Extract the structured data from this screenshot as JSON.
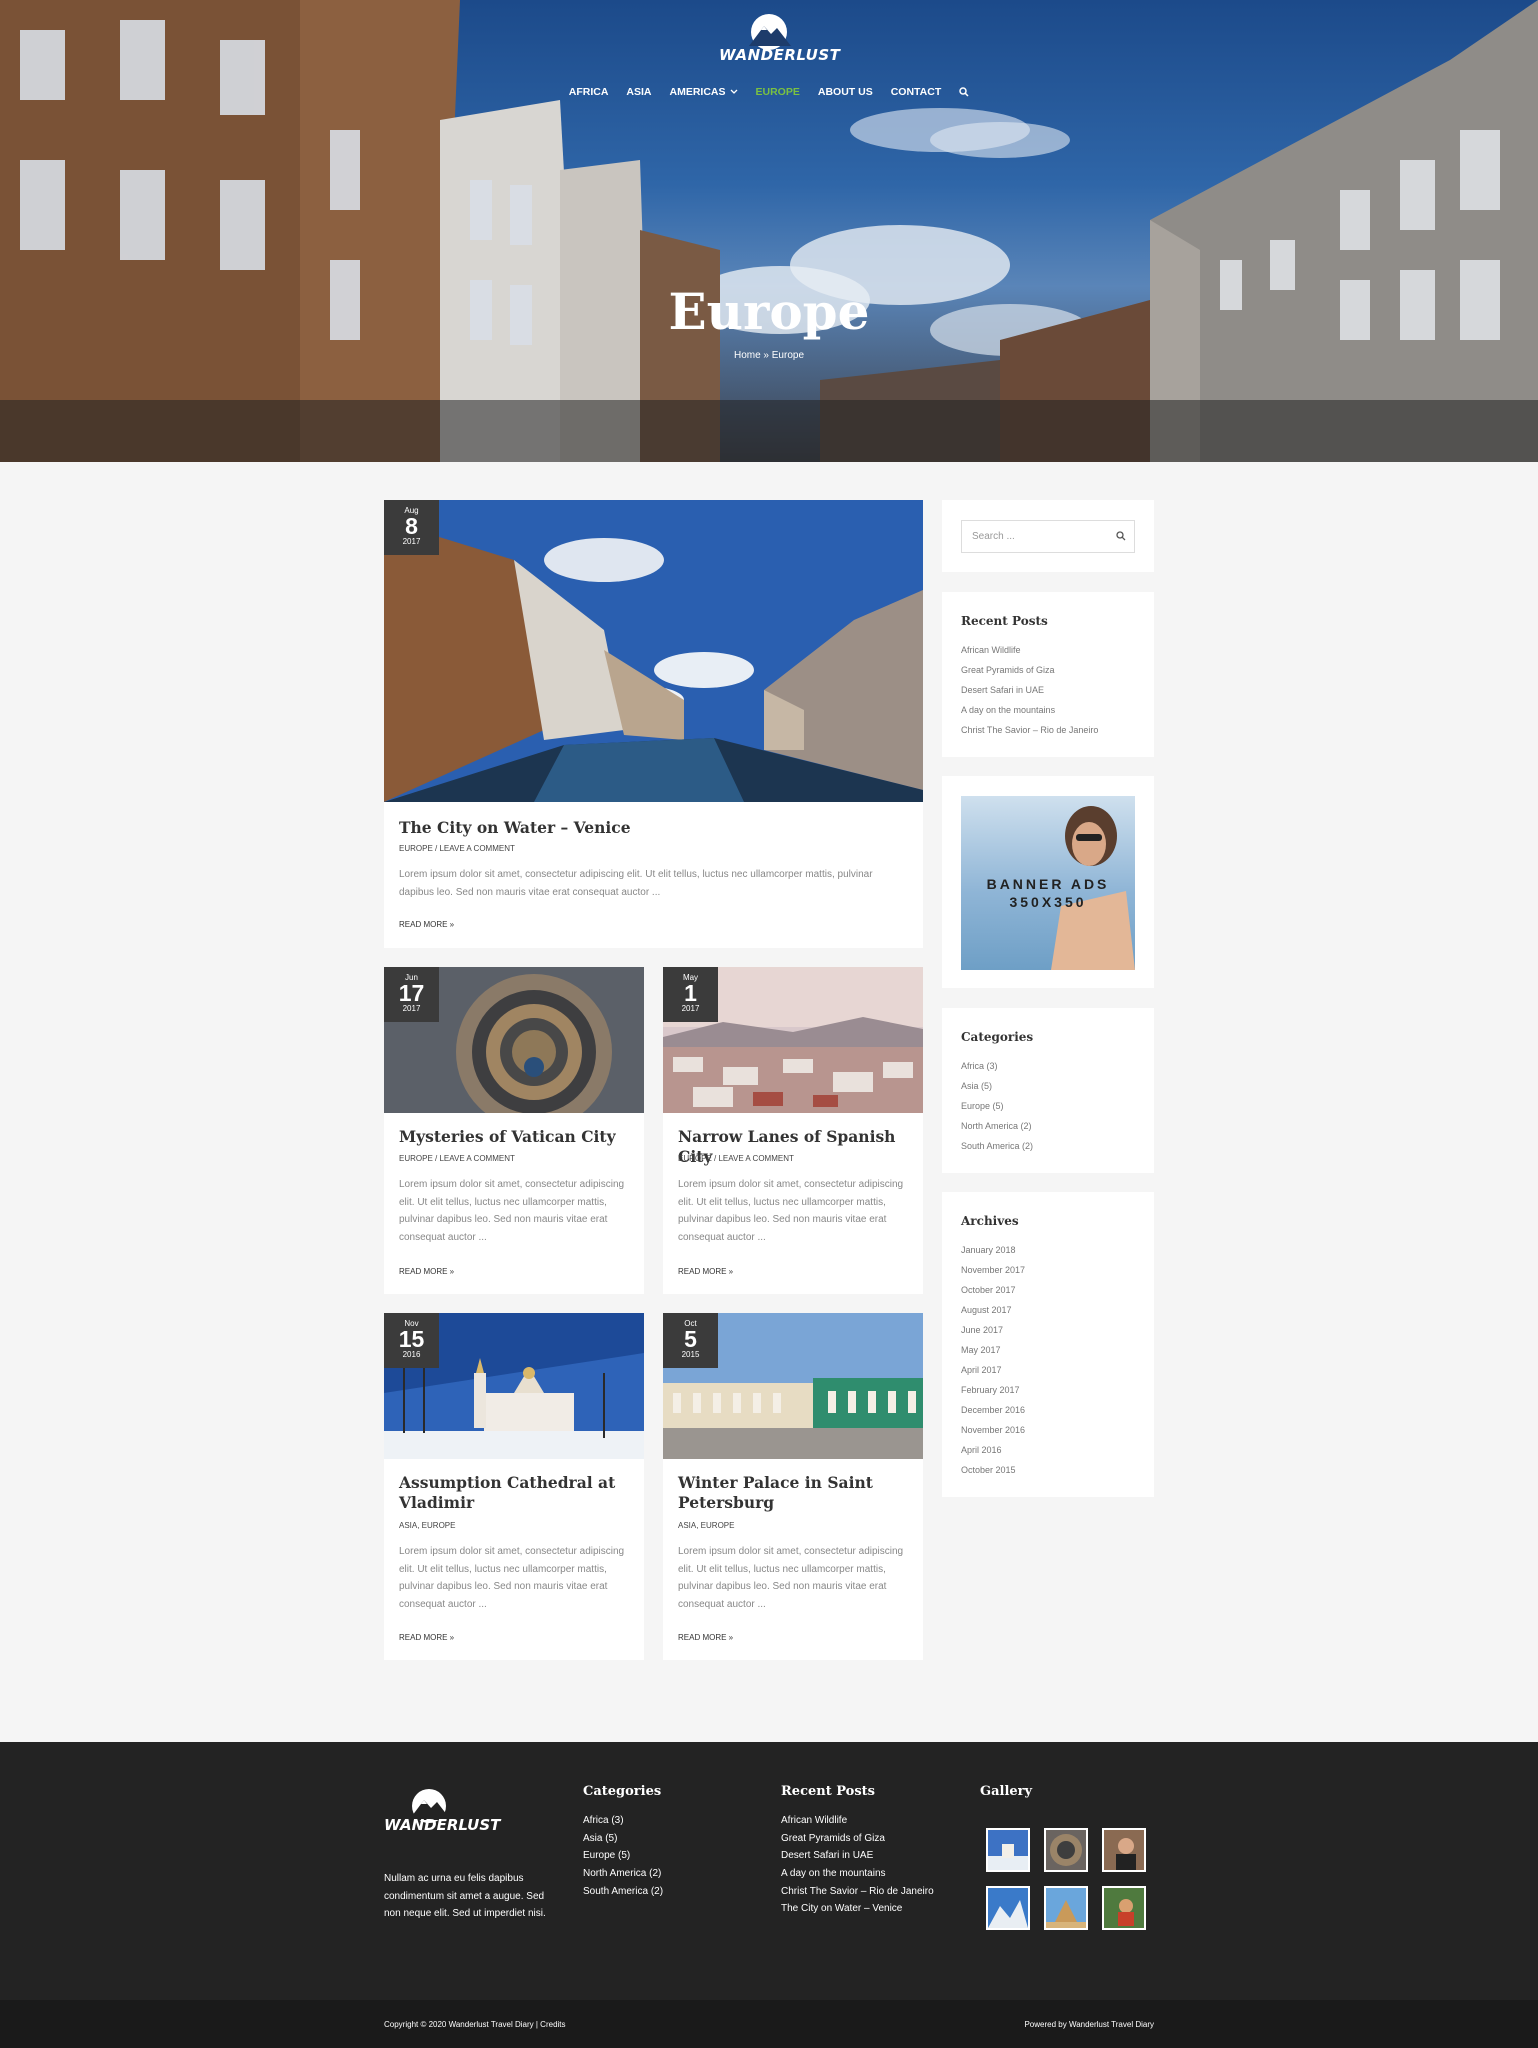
{
  "site": {
    "logo_text": "WANDERLUST",
    "nav": [
      {
        "label": "AFRICA"
      },
      {
        "label": "ASIA"
      },
      {
        "label": "AMERICAS"
      },
      {
        "label": "EUROPE"
      },
      {
        "label": "ABOUT US"
      },
      {
        "label": "CONTACT"
      }
    ],
    "accent_color": "#7ac142"
  },
  "hero": {
    "title": "Europe",
    "breadcrumb": "Home » Europe"
  },
  "posts": [
    {
      "month": "Aug",
      "day": "8",
      "year": "2017",
      "title": "The City on Water – Venice",
      "meta": "EUROPE / LEAVE A COMMENT",
      "excerpt": "Lorem ipsum dolor sit amet, consectetur adipiscing elit. Ut elit tellus, luctus nec ullamcorper mattis, pulvinar dapibus leo. Sed non mauris vitae erat consequat auctor ...",
      "more": "READ MORE »"
    },
    {
      "month": "Jun",
      "day": "17",
      "year": "2017",
      "title": "Mysteries of Vatican City",
      "meta": "EUROPE / LEAVE A COMMENT",
      "excerpt": "Lorem ipsum dolor sit amet, consectetur adipiscing elit. Ut elit tellus, luctus nec ullamcorper mattis, pulvinar dapibus leo. Sed non mauris vitae erat consequat auctor ...",
      "more": "READ MORE »"
    },
    {
      "month": "May",
      "day": "1",
      "year": "2017",
      "title": "Narrow Lanes of Spanish City",
      "meta": "EUROPE / LEAVE A COMMENT",
      "excerpt": "Lorem ipsum dolor sit amet, consectetur adipiscing elit. Ut elit tellus, luctus nec ullamcorper mattis, pulvinar dapibus leo. Sed non mauris vitae erat consequat auctor ...",
      "more": "READ MORE »"
    },
    {
      "month": "Nov",
      "day": "15",
      "year": "2016",
      "title": "Assumption Cathedral at Vladimir",
      "meta": "ASIA, EUROPE",
      "excerpt": "Lorem ipsum dolor sit amet, consectetur adipiscing elit. Ut elit tellus, luctus nec ullamcorper mattis, pulvinar dapibus leo. Sed non mauris vitae erat consequat auctor ...",
      "more": "READ MORE »"
    },
    {
      "month": "Oct",
      "day": "5",
      "year": "2015",
      "title": "Winter Palace in Saint Petersburg",
      "meta": "ASIA, EUROPE",
      "excerpt": "Lorem ipsum dolor sit amet, consectetur adipiscing elit. Ut elit tellus, luctus nec ullamcorper mattis, pulvinar dapibus leo. Sed non mauris vitae erat consequat auctor ...",
      "more": "READ MORE »"
    }
  ],
  "sidebar": {
    "search_placeholder": "Search ...",
    "recent_title": "Recent Posts",
    "recent": [
      "African Wildlife",
      "Great Pyramids of Giza",
      "Desert Safari in UAE",
      "A day on the mountains",
      "Christ The Savior – Rio de Janeiro"
    ],
    "banner_line1": "BANNER ADS",
    "banner_line2": "350X350",
    "categories_title": "Categories",
    "categories": [
      "Africa (3)",
      "Asia (5)",
      "Europe (5)",
      "North America (2)",
      "South America (2)"
    ],
    "archives_title": "Archives",
    "archives": [
      "January 2018",
      "November 2017",
      "October 2017",
      "August 2017",
      "June 2017",
      "May 2017",
      "April 2017",
      "February 2017",
      "December 2016",
      "November 2016",
      "April 2016",
      "October 2015"
    ]
  },
  "footer": {
    "logo_text": "WANDERLUST",
    "description": "Nullam ac urna eu felis dapibus condimentum sit amet a augue. Sed non neque elit. Sed ut imperdiet nisi.",
    "categories_title": "Categories",
    "categories": [
      "Africa (3)",
      "Asia (5)",
      "Europe (5)",
      "North America (2)",
      "South America (2)"
    ],
    "recent_title": "Recent Posts",
    "recent": [
      "African Wildlife",
      "Great Pyramids of Giza",
      "Desert Safari in UAE",
      "A day on the mountains",
      "Christ The Savior – Rio de Janeiro",
      "The City on Water – Venice"
    ],
    "gallery_title": "Gallery",
    "copyright": "Copyright © 2020 Wanderlust Travel Diary | Credits",
    "powered": "Powered by Wanderlust Travel Diary"
  }
}
